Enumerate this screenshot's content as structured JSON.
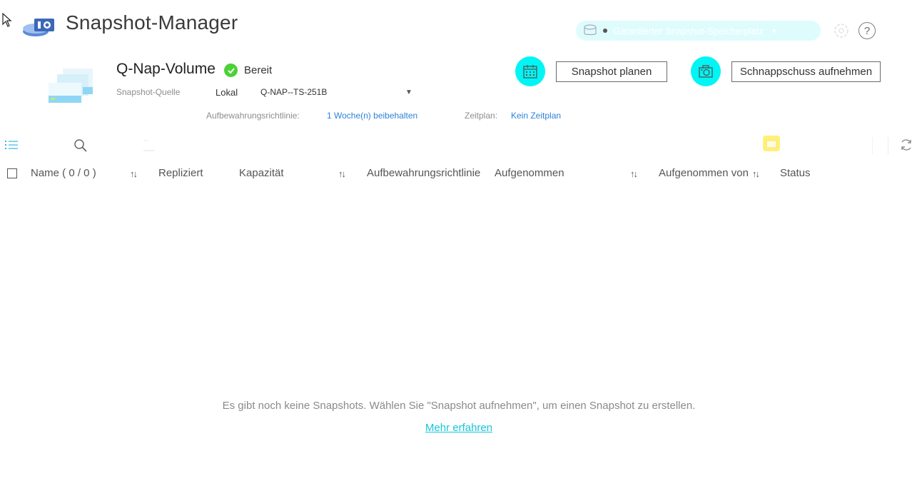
{
  "header": {
    "title": "Snapshot-Manager",
    "space_pill_label": "Garantierter Snapshot-Speicherplatz",
    "help_label": "?"
  },
  "volume": {
    "name": "Q-Nap-Volume",
    "status": "Bereit",
    "source_label": "Snapshot-Quelle",
    "source_type": "Lokal",
    "source_device": "Q-NAP--TS-251B",
    "retention_label": "Aufbewahrungsrichtlinie:",
    "retention_value": "1 Woche(n) beibehalten",
    "schedule_label": "Zeitplan:",
    "schedule_value": "Kein Zeitplan"
  },
  "actions": {
    "plan_label": "Snapshot planen",
    "take_label": "Schnappschuss aufnehmen"
  },
  "table": {
    "columns": {
      "name": "Name ( 0 / 0 )",
      "replicated": "Repliziert",
      "capacity": "Kapazität",
      "retention": "Aufbewahrungsrichtlinie",
      "taken": "Aufgenommen",
      "taken_by": "Aufgenommen von",
      "status": "Status"
    },
    "sort_glyph": "↑↓"
  },
  "empty_state": {
    "message": "Es gibt noch keine Snapshots. Wählen Sie \"Snapshot aufnehmen\", um einen Snapshot zu erstellen.",
    "link": "Mehr erfahren"
  },
  "colors": {
    "accent_cyan": "#00f5f5",
    "link_blue": "#2d83d6",
    "status_green": "#4cd137",
    "learn_more": "#16c6d8"
  },
  "icons": [
    "cursor-icon",
    "app-logo-icon",
    "database-icon",
    "settings-icon",
    "help-icon",
    "volume-icon",
    "check-icon",
    "calendar-icon",
    "camera-icon",
    "list-view-icon",
    "search-icon",
    "filter-icon",
    "folder-icon",
    "refresh-icon",
    "sort-icon"
  ]
}
